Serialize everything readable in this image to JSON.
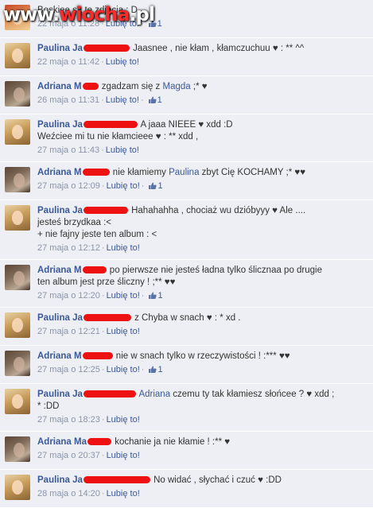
{
  "watermark": {
    "prefix": "www.",
    "brand": "wiocha",
    "suffix": ".pl"
  },
  "ui": {
    "like_label": "Lubię to!",
    "separator": "·"
  },
  "colors": {
    "link": "#3b5998",
    "meta": "#8c94a8",
    "background": "#edeff4",
    "redaction": "#ee1111"
  },
  "comments": [
    {
      "author": "",
      "avatar": "first",
      "mention": "",
      "lines": [
        "Boskiee są te zdjęcia : D"
      ],
      "time": "22 maja o 11:28",
      "likes": "1"
    },
    {
      "author": "Paulina Ja",
      "avatar": "p",
      "mention": "",
      "lines": [
        "Jaasnee , nie kłam , kłamczuchuu ♥ : ** ^^"
      ],
      "time": "22 maja o 11:42",
      "likes": ""
    },
    {
      "author": "Adriana M",
      "avatar": "a",
      "mention": "Magda",
      "lines": [
        "zgadzam się z",
        " ;* ♥"
      ],
      "time": "26 maja o 11:31",
      "likes": "1"
    },
    {
      "author": "Paulina Ja",
      "avatar": "p",
      "mention": "",
      "lines": [
        "A jaaa NIEEE ♥ xdd :D",
        "Weźciee mi tu nie kłamcieee ♥ : ** xdd ,"
      ],
      "time": "27 maja o 11:43",
      "likes": ""
    },
    {
      "author": "Adriana M",
      "avatar": "a",
      "mention": "Paulina",
      "lines": [
        "nie kłamiemy",
        " zbyt Cię KOCHAMY ;* ♥♥"
      ],
      "time": "27 maja o 12:09",
      "likes": "1"
    },
    {
      "author": "Paulina Ja",
      "avatar": "p",
      "mention": "",
      "lines": [
        "Hahahahha , chociaż wu dzióbyyy ♥ Ale ....",
        "jesteś brzydkaa :<",
        "+ nie fajny jeste ten album : <"
      ],
      "time": "27 maja o 12:12",
      "likes": ""
    },
    {
      "author": "Adriana M",
      "avatar": "a",
      "mention": "",
      "lines": [
        "po pierwsze nie jesteś ładna tylko ślicznaa po drugie",
        "ten album jest prze śliczny ! ;** ♥♥"
      ],
      "time": "27 maja o 12:20",
      "likes": "1"
    },
    {
      "author": "Paulina Ja",
      "avatar": "p",
      "mention": "",
      "lines": [
        "z Chyba w snach ♥ : * xd ."
      ],
      "time": "27 maja o 12:21",
      "likes": ""
    },
    {
      "author": "Adriana M",
      "avatar": "a",
      "mention": "",
      "lines": [
        "nie w snach tylko w rzeczywistości ! :*** ♥♥"
      ],
      "time": "27 maja o 12:25",
      "likes": "1"
    },
    {
      "author": "Paulina Ja",
      "avatar": "p",
      "mention": "Adriana",
      "lines": [
        "",
        " czemu ty tak kłamiesz słońcee ? ♥ xdd ;",
        "* :DD"
      ],
      "time": "27 maja o 18:23",
      "likes": ""
    },
    {
      "author": "Adriana Ma",
      "avatar": "a",
      "mention": "",
      "lines": [
        "kochanie ja nie kłamie ! :** ♥"
      ],
      "time": "27 maja o 20:37",
      "likes": ""
    },
    {
      "author": "Paulina Ja",
      "avatar": "p",
      "mention": "",
      "lines": [
        "No widać , słychać i czuć ♥ :DD"
      ],
      "time": "28 maja o 14:20",
      "likes": ""
    }
  ]
}
